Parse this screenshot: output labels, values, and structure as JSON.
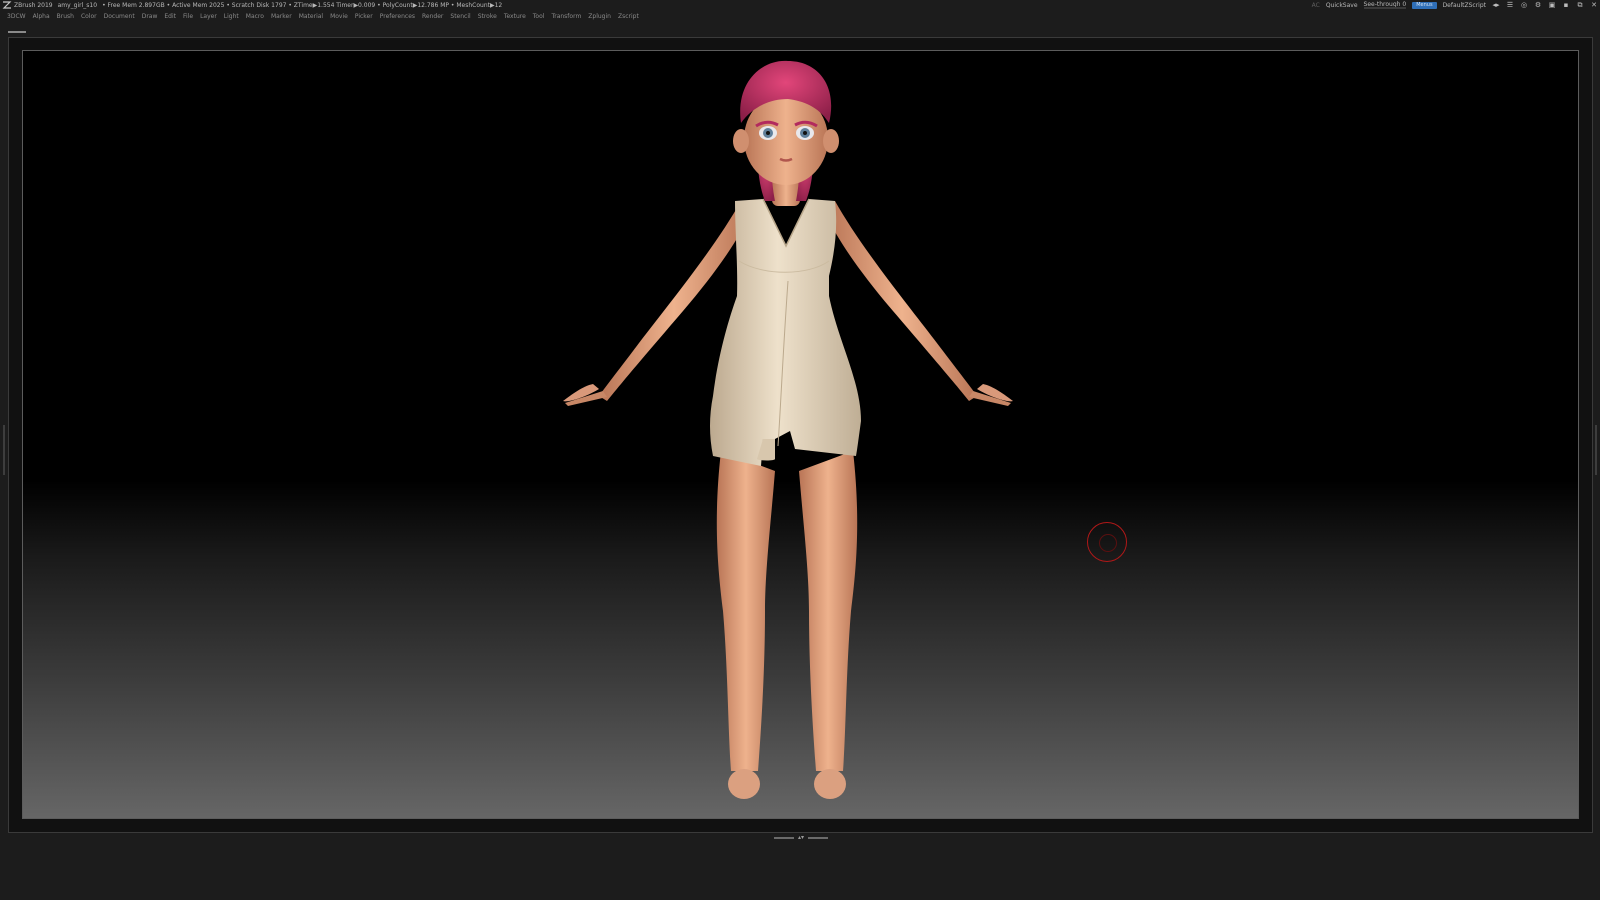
{
  "titlebar": {
    "app_name": "ZBrush 2019",
    "document_name": "amy_girl_s10",
    "stats": "• Free Mem 2.897GB • Active Mem 2025 • Scratch Disk 1797 •  ZTime▶1.554 Timer▶0.009 • PolyCount▶12.786 MP • MeshCount▶12",
    "ac_label": "AC",
    "quicksave_label": "QuickSave",
    "see_through_label": "See-through",
    "see_through_value": "0",
    "see_through_fraction": 0,
    "menus_toggle_label": "Menus",
    "script_label": "DefaultZScript"
  },
  "menubar": {
    "items": [
      "3DCW",
      "Alpha",
      "Brush",
      "Color",
      "Document",
      "Draw",
      "Edit",
      "File",
      "Layer",
      "Light",
      "Macro",
      "Marker",
      "Material",
      "Movie",
      "Picker",
      "Preferences",
      "Render",
      "Stencil",
      "Stroke",
      "Texture",
      "Tool",
      "Transform",
      "Zplugin",
      "Zscript"
    ]
  },
  "colors": {
    "background": "#1c1c1c",
    "skin": "#e0a582",
    "dress": "#e6d5bd",
    "hair": "#c7386a",
    "brush_cursor": "#b01818",
    "menus_accent": "#2f6fb8"
  }
}
